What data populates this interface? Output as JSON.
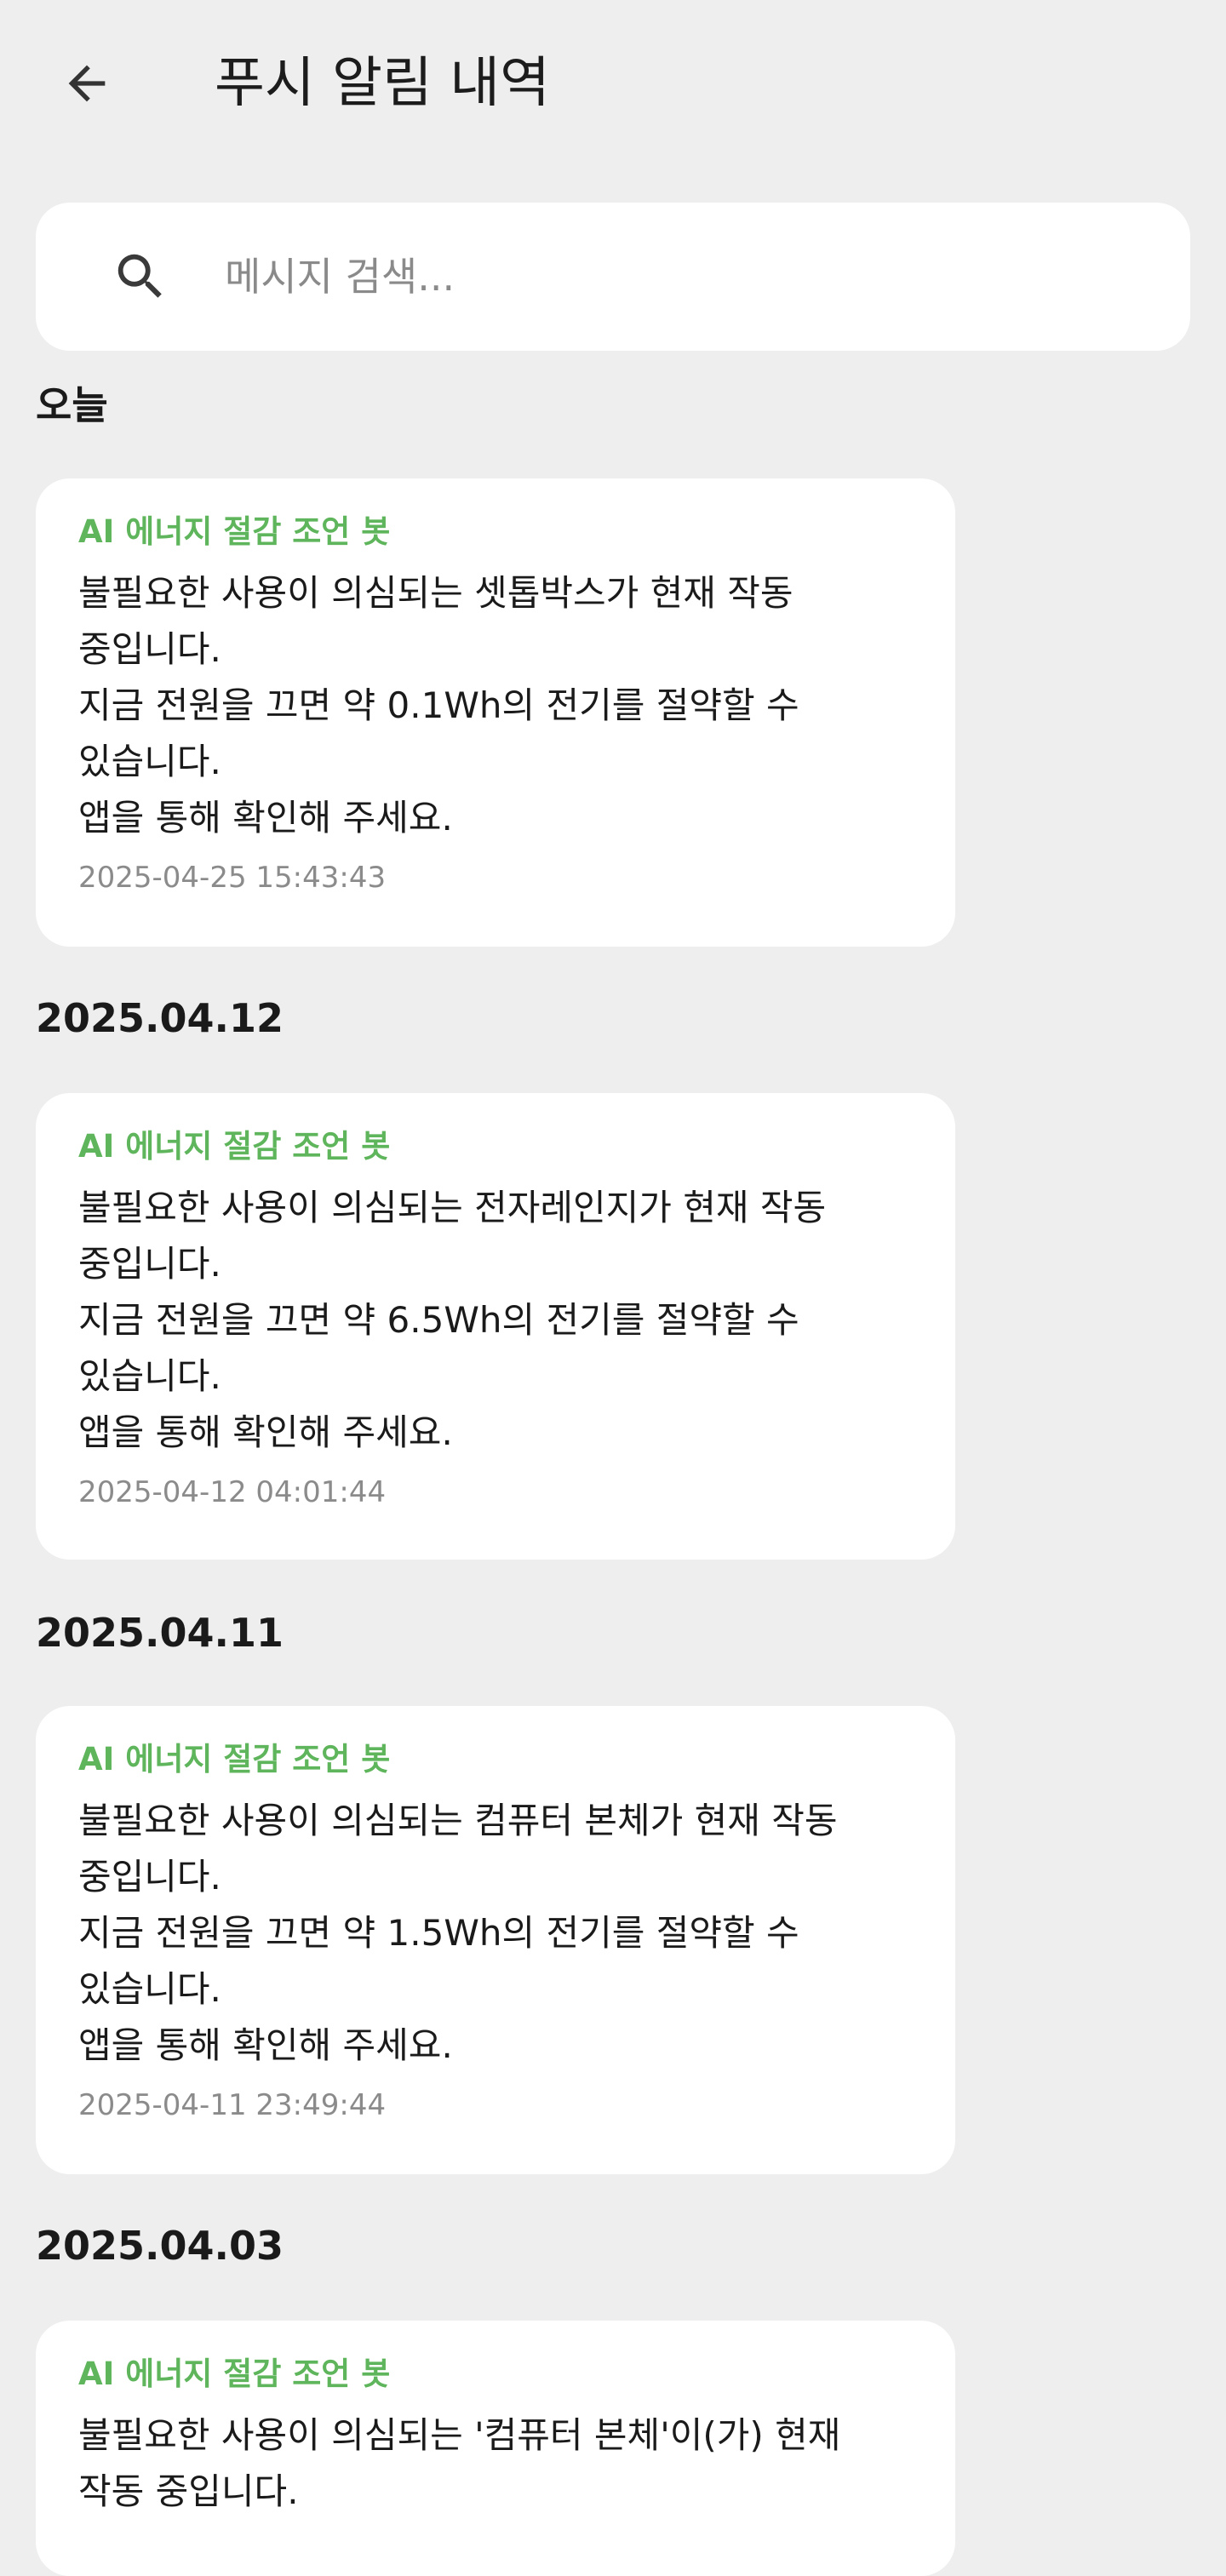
{
  "app_bar": {
    "title": "푸시 알림 내역",
    "back_icon": "arrow-left-icon"
  },
  "search": {
    "placeholder": "메시지 검색...",
    "value": "",
    "icon": "search-icon"
  },
  "colors": {
    "background": "#eeeeee",
    "card": "#ffffff",
    "sender": "#5fb55b",
    "timestamp": "#8b8b8b"
  },
  "sections": [
    {
      "header": "오늘",
      "notification": {
        "sender": "AI 에너지 절감 조언 봇",
        "message": "불필요한 사용이 의심되는 셋톱박스가 현재 작동 중입니다.\n지금 전원을 끄면 약 0.1Wh의 전기를 절약할 수 있습니다.\n앱을 통해 확인해 주세요.",
        "timestamp": "2025-04-25 15:43:43"
      }
    },
    {
      "header": "2025.04.12",
      "notification": {
        "sender": "AI 에너지 절감 조언 봇",
        "message": "불필요한 사용이 의심되는 전자레인지가 현재 작동 중입니다.\n지금 전원을 끄면 약 6.5Wh의 전기를 절약할 수 있습니다.\n앱을 통해 확인해 주세요.",
        "timestamp": "2025-04-12 04:01:44"
      }
    },
    {
      "header": "2025.04.11",
      "notification": {
        "sender": "AI 에너지 절감 조언 봇",
        "message": "불필요한 사용이 의심되는 컴퓨터 본체가 현재 작동 중입니다.\n지금 전원을 끄면 약 1.5Wh의 전기를 절약할 수 있습니다.\n앱을 통해 확인해 주세요.",
        "timestamp": "2025-04-11 23:49:44"
      }
    },
    {
      "header": "2025.04.03",
      "notification": {
        "sender": "AI 에너지 절감 조언 봇",
        "message": "불필요한 사용이 의심되는 '컴퓨터 본체'이(가) 현재 작동 중입니다.",
        "timestamp": ""
      }
    }
  ]
}
